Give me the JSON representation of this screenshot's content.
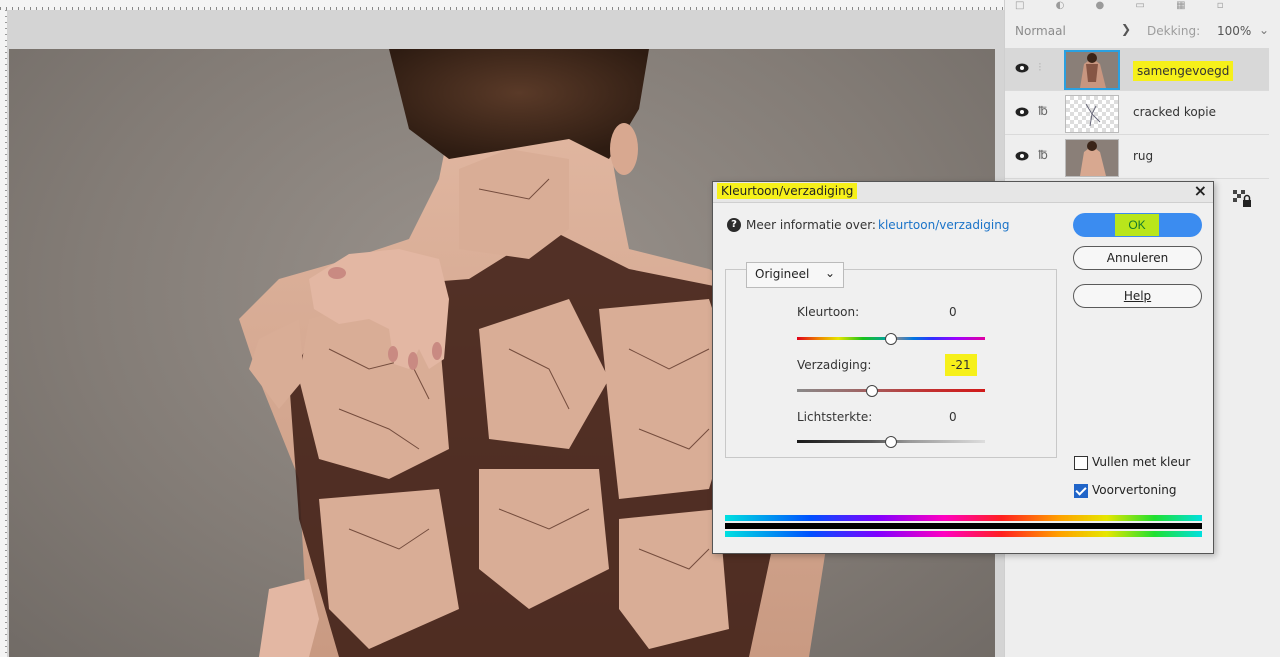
{
  "layers_panel": {
    "blend_mode": "Normaal",
    "opacity_label": "Dekking:",
    "opacity_value": "100%",
    "layers": [
      {
        "name": "samengevoegd",
        "selected": true
      },
      {
        "name": "cracked kopie",
        "selected": false
      },
      {
        "name": "rug",
        "selected": false
      }
    ]
  },
  "dialog": {
    "title": "Kleurtoon/verzadiging",
    "close": "×",
    "info_label": "Meer informatie over:",
    "info_link": "kleurtoon/verzadiging",
    "ok": "OK",
    "cancel": "Annuleren",
    "help": "Help",
    "preset": "Origineel",
    "hue": {
      "label": "Kleurtoon:",
      "value": "0",
      "position": 0.5
    },
    "saturation": {
      "label": "Verzadiging:",
      "value": "-21",
      "position": 0.4
    },
    "lightness": {
      "label": "Lichtsterkte:",
      "value": "0",
      "position": 0.5
    },
    "colorize": {
      "label": "Vullen met kleur",
      "checked": false
    },
    "preview": {
      "label": "Voorvertoning",
      "checked": true
    }
  },
  "colors": {
    "highlight": "#f6f01a",
    "ok_button": "#3b8cf0",
    "selected_layer_border": "#2aa0e0"
  }
}
